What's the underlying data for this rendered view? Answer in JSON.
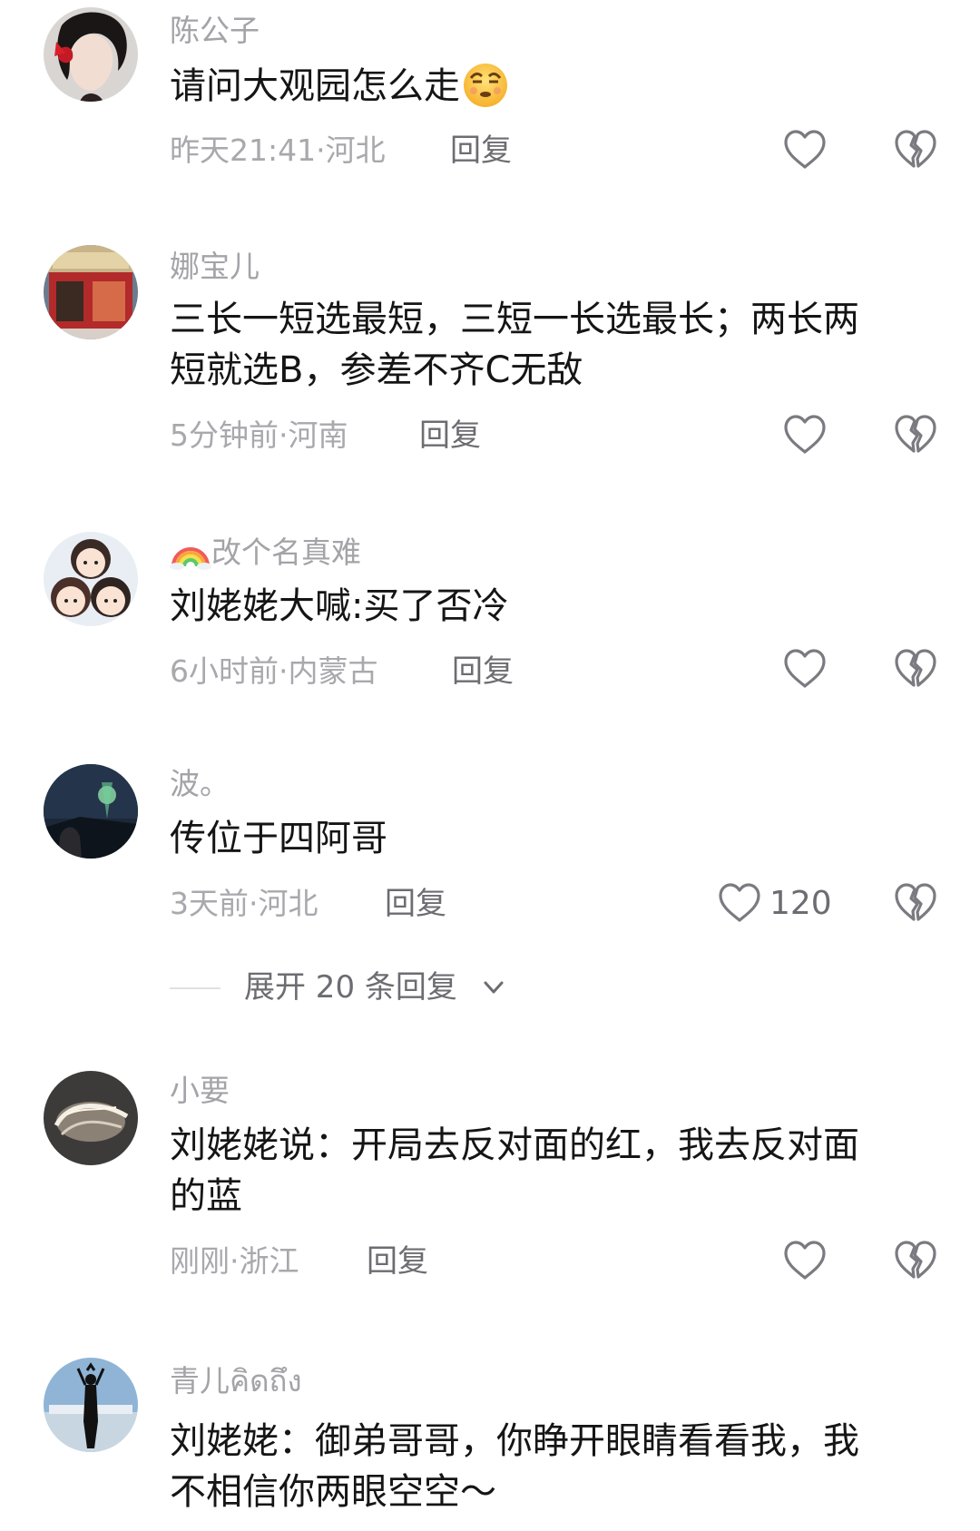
{
  "comments": [
    {
      "username": "陈公子",
      "text": "请问大观园怎么走",
      "emoji": "smirking-face-emoji",
      "meta": "昨天21:41·河北",
      "reply": "回复",
      "likes": ""
    },
    {
      "username": "娜宝儿",
      "text_line1": "三长一短选最短，三短一长选最长；两长两",
      "text_line2": "短就选B，参差不齐C无敌",
      "meta": "5分钟前·河南",
      "reply": "回复",
      "likes": ""
    },
    {
      "username_icon": "rainbow-emoji",
      "username": "改个名真难",
      "text": "刘姥姥大喊:买了否冷",
      "meta": "6小时前·内蒙古",
      "reply": "回复",
      "likes": ""
    },
    {
      "username": "波。",
      "text": "传位于四阿哥",
      "meta": "3天前·河北",
      "reply": "回复",
      "likes": "120"
    },
    {
      "username": "小要",
      "text_line1": "刘姥姥说：开局去反对面的红，我去反对面",
      "text_line2": "的蓝",
      "meta": "刚刚·浙江",
      "reply": "回复",
      "likes": ""
    },
    {
      "username": "青儿คิดถึง",
      "text_line1": "刘姥姥：御弟哥哥，你睁开眼睛看看我，我",
      "text_line2": "不相信你两眼空空～"
    }
  ],
  "expand_replies": "展开 20 条回复",
  "icons": {
    "like": "heart-outline-icon",
    "dislike": "broken-heart-icon",
    "expand": "chevron-down-icon"
  },
  "colors": {
    "username": "#a3a3a8",
    "meta": "#a8a8ad",
    "reply": "#6c6c72",
    "text": "#151515"
  }
}
